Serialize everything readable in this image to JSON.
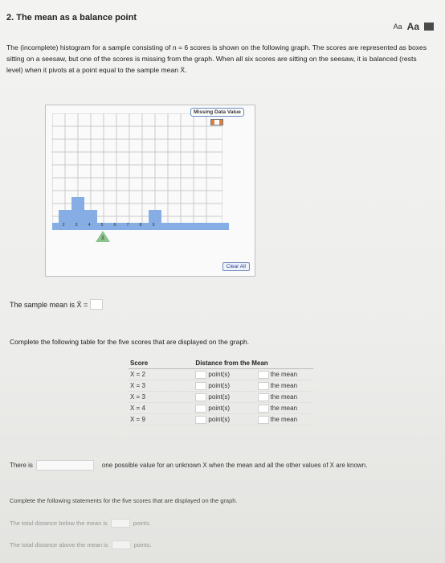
{
  "question": {
    "title": "2. The mean as a balance point",
    "intro": "The (incomplete) histogram for a sample consisting of n = 6 scores is shown on the following graph. The scores are represented as boxes sitting on a seesaw, but one of the scores is missing from the graph. When all six scores are sitting on the seesaw, it is balanced (rests level) when it pivots at a point equal to the sample mean X̄."
  },
  "font_controls": {
    "small": "Aa",
    "large": "Aa"
  },
  "graph": {
    "missing_label": "Missing Data Value",
    "ticks": [
      "2",
      "3",
      "4",
      "5",
      "6",
      "7",
      "8",
      "9"
    ],
    "fulcrum_label": "X̄",
    "clear_label": "Clear All",
    "boxes": [
      {
        "score": 3,
        "height": 1
      },
      {
        "score": 2,
        "height": 1
      },
      {
        "score": 4,
        "height": 1
      },
      {
        "score": 9,
        "height": 1
      }
    ],
    "fulcrum_at": 5
  },
  "mean_line": {
    "text": "The sample mean is X̄ ="
  },
  "table_prompt": "Complete the following table for the five scores that are displayed on the graph.",
  "table": {
    "headers": [
      "Score",
      "Distance from the Mean",
      ""
    ],
    "rows": [
      {
        "score": "X = 2",
        "unit": "point(s)",
        "relation": "the mean"
      },
      {
        "score": "X = 3",
        "unit": "point(s)",
        "relation": "the mean"
      },
      {
        "score": "X = 3",
        "unit": "point(s)",
        "relation": "the mean"
      },
      {
        "score": "X = 4",
        "unit": "point(s)",
        "relation": "the mean"
      },
      {
        "score": "X = 9",
        "unit": "point(s)",
        "relation": "the mean"
      }
    ]
  },
  "there_is": {
    "prefix": "There is",
    "suffix": "one possible value for an unknown X when the mean and all the other values of X are known."
  },
  "statements": {
    "intro": "Complete the following statements for the five scores that are displayed on the graph.",
    "below": {
      "prefix": "The total distance below the mean is",
      "suffix": "points."
    },
    "above": {
      "prefix": "The total distance above the mean is",
      "suffix": "points."
    }
  }
}
